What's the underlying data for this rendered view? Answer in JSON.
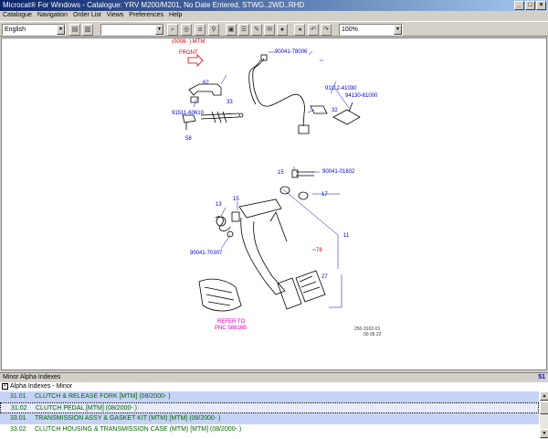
{
  "window": {
    "title": "Microcat® For Windows - Catalogue: YRV M200/M201, No Date Entered,  STWG..2WD..RHD",
    "buttons": [
      "_",
      "□",
      "×"
    ]
  },
  "menu": [
    "Catalogue",
    "Navigation",
    "Order List",
    "Views",
    "Preferences",
    "Help"
  ],
  "toolbar": {
    "language": "English",
    "part_search": "",
    "zoom": "100%"
  },
  "diagram": {
    "header_code": "(0008-    ) MTM",
    "front_label": "FRONT",
    "labels": {
      "l90041_78006": "90041-78006",
      "l62": "62",
      "l33": "33",
      "l91511": "91511-60610",
      "l58": "58",
      "l91112": "91112-41030",
      "l94130": "94130-61000",
      "l32": "32",
      "l15a": "15",
      "l90041_01602": "90041-01602",
      "l17": "17",
      "l13": "13",
      "l15b": "15",
      "l11": "11",
      "l90041_70307": "90041-70307",
      "l78": "78",
      "l27": "27"
    },
    "refer_to_line1": "REFER TO",
    "refer_to_line2": "PNC 58816B",
    "illustration_code": "250-3102-01",
    "illustration_date": "00 06 22"
  },
  "panel": {
    "title": "Minor Alpha Indexes",
    "count": "51",
    "subheader": "Alpha Indexes - Minor"
  },
  "rows": [
    {
      "code": "31.01",
      "text": "CLUTCH & RELEASE FORK   [MTM]  (08/2000- )"
    },
    {
      "code": "31.02",
      "text": "CLUTCH PEDAL   [MTM]  (08/2000- )"
    },
    {
      "code": "33.01",
      "text": "TRANSMISSION ASSY & GASKET KIT (MTM)    [MTM]  (08/2000- )"
    },
    {
      "code": "33.02",
      "text": "CLUTCH HOUSING & TRANSMISSION CASE (MTM)    [MTM]  (08/2000- )"
    }
  ],
  "colors": {
    "row_text": "#006600",
    "row_shade": "#c6d3f7",
    "part_label": "#0000cc",
    "highlight_label": "#d00000",
    "refer_label": "#e000c0"
  }
}
